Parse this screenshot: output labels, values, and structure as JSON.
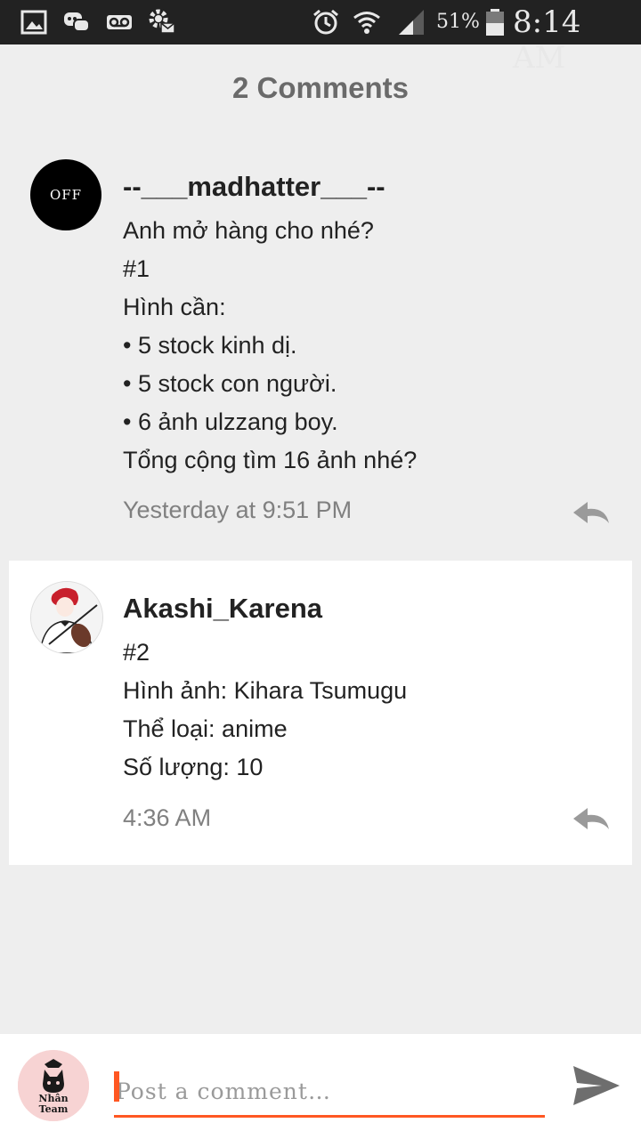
{
  "status_bar": {
    "icons_left": [
      "gallery-icon",
      "chat-bubbles-icon",
      "voicemail-icon",
      "gear-mail-icon"
    ],
    "icons_right": [
      "alarm-icon",
      "wifi-icon",
      "cell-signal-icon",
      "battery-icon"
    ],
    "battery_percent": "51%",
    "time": "8:14 AM"
  },
  "comments_heading": "2 Comments",
  "comments": [
    {
      "avatar_text": "OFF",
      "username": "--___madhatter___--",
      "lines": [
        "Anh mở hàng cho nhé?",
        "#1",
        "Hình cần:",
        "• 5 stock kinh dị.",
        "• 5 stock con người.",
        "• 6 ảnh ulzzang boy.",
        "Tổng cộng tìm 16 ảnh nhé?"
      ],
      "timestamp": "Yesterday at 9:51 PM"
    },
    {
      "username": "Akashi_Karena",
      "lines": [
        "#2",
        "Hình ảnh: Kihara Tsumugu",
        "Thể loại: anime",
        "Số lượng: 10"
      ],
      "timestamp": "4:36 AM"
    }
  ],
  "composer": {
    "avatar_text": "Nhân Team",
    "placeholder": "Post a comment…",
    "accent_color": "#ff5722"
  },
  "colors": {
    "background": "#eeeeee",
    "status_bar": "#222222",
    "highlight_card": "#ffffff"
  }
}
